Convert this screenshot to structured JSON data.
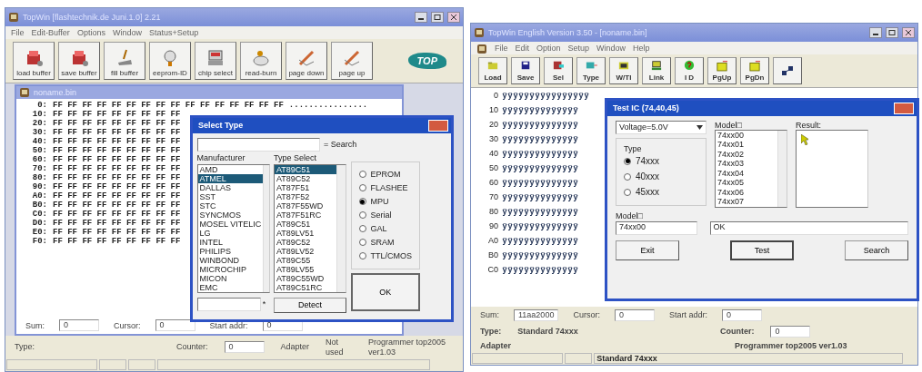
{
  "left_window": {
    "title": "TopWin [flashtechnik.de Juni.1.0] 2.21",
    "menu": [
      "File",
      "Edit-Buffer",
      "Options",
      "Window",
      "Status+Setup"
    ],
    "toolbar": [
      {
        "label": "load buffer"
      },
      {
        "label": "save buffer"
      },
      {
        "label": "fill buffer"
      },
      {
        "label": "eeprom-ID"
      },
      {
        "label": "chip select"
      },
      {
        "label": "read-burn"
      },
      {
        "label": "page down"
      },
      {
        "label": "page up"
      }
    ],
    "logo": "TOP",
    "child": {
      "title": "noname.bin",
      "hex_rows": [
        {
          "address": "0:",
          "bytes": "FF FF FF FF FF FF FF FF FF FF FF FF FF FF FF FF",
          "ascii": "................"
        },
        {
          "address": "10:",
          "bytes": "FF FF FF FF FF FF FF FF FF"
        },
        {
          "address": "20:",
          "bytes": "FF FF FF FF FF FF FF FF FF"
        },
        {
          "address": "30:",
          "bytes": "FF FF FF FF FF FF FF FF FF"
        },
        {
          "address": "40:",
          "bytes": "FF FF FF FF FF FF FF FF FF"
        },
        {
          "address": "50:",
          "bytes": "FF FF FF FF FF FF FF FF FF"
        },
        {
          "address": "60:",
          "bytes": "FF FF FF FF FF FF FF FF FF"
        },
        {
          "address": "70:",
          "bytes": "FF FF FF FF FF FF FF FF FF"
        },
        {
          "address": "80:",
          "bytes": "FF FF FF FF FF FF FF FF FF"
        },
        {
          "address": "90:",
          "bytes": "FF FF FF FF FF FF FF FF FF"
        },
        {
          "address": "A0:",
          "bytes": "FF FF FF FF FF FF FF FF FF"
        },
        {
          "address": "B0:",
          "bytes": "FF FF FF FF FF FF FF FF FF"
        },
        {
          "address": "C0:",
          "bytes": "FF FF FF FF FF FF FF FF FF"
        },
        {
          "address": "D0:",
          "bytes": "FF FF FF FF FF FF FF FF FF"
        },
        {
          "address": "E0:",
          "bytes": "FF FF FF FF FF FF FF FF FF"
        },
        {
          "address": "F0:",
          "bytes": "FF FF FF FF FF FF FF FF FF"
        }
      ],
      "fields": [
        {
          "label": "Sum:",
          "value": "0"
        },
        {
          "label": "Cursor:",
          "value": "0"
        },
        {
          "label": "Start addr:",
          "value": "0"
        }
      ]
    },
    "status": {
      "type_label": "Type:",
      "counter_label": "Counter:",
      "counter_value": "0",
      "adapter": "Adapter",
      "not_used": "Not used",
      "programmer": "Programmer top2005 ver1.03"
    },
    "dialog": {
      "title": "Select Type",
      "search_label": "= Search",
      "manufacturer_label": "Manufacturer",
      "type_label": "Type Select",
      "manufacturers": [
        {
          "name": "AMD",
          "selected": false
        },
        {
          "name": "ATMEL",
          "selected": true
        },
        {
          "name": "DALLAS",
          "selected": false
        },
        {
          "name": "SST",
          "selected": false
        },
        {
          "name": "STC",
          "selected": false
        },
        {
          "name": "SYNCMOS",
          "selected": false
        },
        {
          "name": "MOSEL VITELIC",
          "selected": false
        },
        {
          "name": "LG",
          "selected": false
        },
        {
          "name": "INTEL",
          "selected": false
        },
        {
          "name": "PHILIPS",
          "selected": false
        },
        {
          "name": "WINBOND",
          "selected": false
        },
        {
          "name": "MICROCHIP",
          "selected": false
        },
        {
          "name": "MICON",
          "selected": false
        },
        {
          "name": "EMC",
          "selected": false
        }
      ],
      "types": [
        {
          "name": "AT89C51",
          "selected": true
        },
        {
          "name": "AT89C52",
          "selected": false
        },
        {
          "name": "AT87F51",
          "selected": false
        },
        {
          "name": "AT87F52",
          "selected": false
        },
        {
          "name": "AT87F55WD",
          "selected": false
        },
        {
          "name": "AT87F51RC",
          "selected": false
        },
        {
          "name": "AT89C51",
          "selected": false
        },
        {
          "name": "AT89LV51",
          "selected": false
        },
        {
          "name": "AT89C52",
          "selected": false
        },
        {
          "name": "AT89LV52",
          "selected": false
        },
        {
          "name": "AT89C55",
          "selected": false
        },
        {
          "name": "AT89LV55",
          "selected": false
        },
        {
          "name": "AT89C55WD",
          "selected": false
        },
        {
          "name": "AT89C51RC",
          "selected": false
        }
      ],
      "device_classes": [
        {
          "label": "EPROM",
          "selected": false
        },
        {
          "label": "FLASHEE",
          "selected": false
        },
        {
          "label": "MPU",
          "selected": true
        },
        {
          "label": "Serial",
          "selected": false
        },
        {
          "label": "GAL",
          "selected": false
        },
        {
          "label": "SRAM",
          "selected": false
        },
        {
          "label": "TTL/CMOS",
          "selected": false
        }
      ],
      "wildcard": "*",
      "detect_button": "Detect",
      "ok_button": "OK"
    }
  },
  "right_window": {
    "title": "TopWin English Version 3.50 - [noname.bin]",
    "menu": [
      "File",
      "Edit",
      "Option",
      "Setup",
      "Window",
      "Help"
    ],
    "toolbar": [
      {
        "label": "Load"
      },
      {
        "label": "Save"
      },
      {
        "label": "Sel"
      },
      {
        "label": "Type"
      },
      {
        "label": "W/TI"
      },
      {
        "label": "Link"
      },
      {
        "label": "I D"
      },
      {
        "label": "PgUp"
      },
      {
        "label": "PgDn"
      }
    ],
    "hex_rows": [
      {
        "address": "0",
        "glyphs": "ÿÿÿÿÿÿÿÿÿÿÿÿÿÿÿÿ"
      },
      {
        "address": "10",
        "glyphs": "ÿÿÿÿÿÿÿÿÿÿÿÿÿÿ"
      },
      {
        "address": "20",
        "glyphs": "ÿÿÿÿÿÿÿÿÿÿÿÿÿÿ"
      },
      {
        "address": "30",
        "glyphs": "ÿÿÿÿÿÿÿÿÿÿÿÿÿÿ"
      },
      {
        "address": "40",
        "glyphs": "ÿÿÿÿÿÿÿÿÿÿÿÿÿÿ"
      },
      {
        "address": "50",
        "glyphs": "ÿÿÿÿÿÿÿÿÿÿÿÿÿÿ"
      },
      {
        "address": "60",
        "glyphs": "ÿÿÿÿÿÿÿÿÿÿÿÿÿÿ"
      },
      {
        "address": "70",
        "glyphs": "ÿÿÿÿÿÿÿÿÿÿÿÿÿÿ"
      },
      {
        "address": "80",
        "glyphs": "ÿÿÿÿÿÿÿÿÿÿÿÿÿÿ"
      },
      {
        "address": "90",
        "glyphs": "ÿÿÿÿÿÿÿÿÿÿÿÿÿÿ"
      },
      {
        "address": "A0",
        "glyphs": "ÿÿÿÿÿÿÿÿÿÿÿÿÿÿ"
      },
      {
        "address": "B0",
        "glyphs": "ÿÿÿÿÿÿÿÿÿÿÿÿÿÿ"
      },
      {
        "address": "C0",
        "glyphs": "ÿÿÿÿÿÿÿÿÿÿÿÿÿÿ"
      }
    ],
    "fields": [
      {
        "label": "Sum:",
        "value": "11aa2000"
      },
      {
        "label": "Cursor:",
        "value": "0"
      },
      {
        "label": "Start addr:",
        "value": "0"
      }
    ],
    "status": {
      "type_label": "Type:",
      "type_value": "Standard 74xxx",
      "counter_label": "Counter:",
      "counter_value": "0",
      "adapter": "Adapter",
      "programmer": "Programmer top2005 ver1.03",
      "bar_text": "Standard 74xxx"
    },
    "dialog": {
      "title": "Test IC (74,40,45)",
      "voltage": "Voltage=5.0V",
      "type_group": "Type",
      "types": [
        {
          "label": "74xxx",
          "selected": true
        },
        {
          "label": "40xxx",
          "selected": false
        },
        {
          "label": "45xxx",
          "selected": false
        }
      ],
      "model_list_label": "Model□",
      "models": [
        "74xx00",
        "74xx01",
        "74xx02",
        "74xx03",
        "74xx04",
        "74xx05",
        "74xx06",
        "74xx07"
      ],
      "result_label": "Result:",
      "model_label": "Model□",
      "model_value": "74xx00",
      "message": "OK",
      "buttons": [
        "Exit",
        "Test",
        "Search"
      ]
    }
  }
}
